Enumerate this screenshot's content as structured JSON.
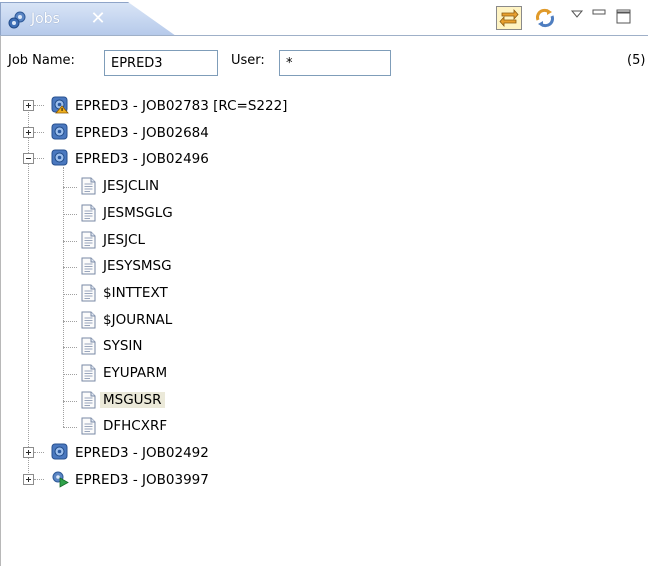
{
  "view": {
    "tab_title": "Jobs",
    "close_glyph": "✕",
    "toolbar_icons": [
      "link-with-editor-icon",
      "synchronize-icon",
      "view-menu-icon",
      "minimize-icon",
      "maximize-icon"
    ]
  },
  "filter": {
    "job_name_label": "Job Name:",
    "job_name_value": "EPRED3",
    "user_label": "User:",
    "user_value": "*",
    "count_text": "(5)"
  },
  "tree": {
    "jobs": [
      {
        "label": "EPRED3 - JOB02783  [RC=S222]",
        "status": "abend",
        "expanded": false
      },
      {
        "label": "EPRED3 - JOB02684",
        "status": "complete",
        "expanded": false
      },
      {
        "label": "EPRED3 - JOB02496",
        "status": "complete",
        "expanded": true,
        "files": [
          "JESJCLIN",
          "JESMSGLG",
          "JESJCL",
          "JESYSMSG",
          "$INTTEXT",
          "$JOURNAL",
          "SYSIN",
          "EYUPARM",
          "MSGUSR",
          "DFHCXRF"
        ],
        "selected_file": "MSGUSR"
      },
      {
        "label": "EPRED3 - JOB02492",
        "status": "complete",
        "expanded": false
      },
      {
        "label": "EPRED3 - JOB03997",
        "status": "running",
        "expanded": false
      }
    ]
  },
  "colors": {
    "tab_gradient_top": "#d8e4f6",
    "tab_gradient_bottom": "#b5c9ea",
    "selection": "#ebe9d9",
    "field_border": "#7f9db9"
  }
}
